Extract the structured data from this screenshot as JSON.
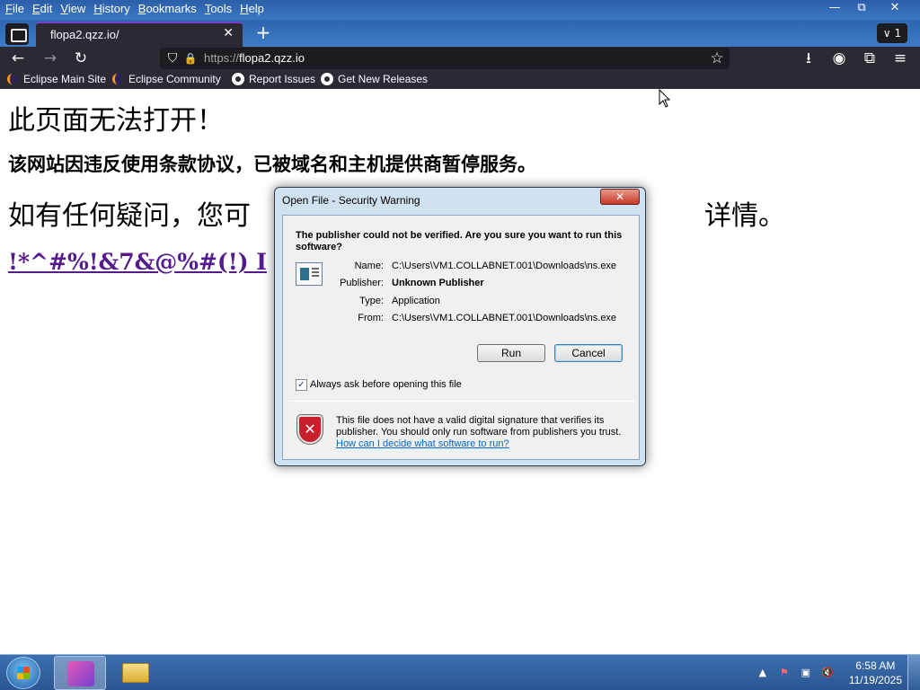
{
  "menu": [
    "File",
    "Edit",
    "View",
    "History",
    "Bookmarks",
    "Tools",
    "Help"
  ],
  "window_controls": {
    "minimize": "—",
    "restore": "⧉",
    "close": "✕"
  },
  "tab": {
    "title": "flopa2.qzz.io/",
    "close": "✕",
    "new_tab": "+",
    "count": "∨ 1"
  },
  "nav": {
    "back": "←",
    "forward": "→",
    "reload": "↻",
    "shield": "⛉",
    "lock": "🔒",
    "star": "☆",
    "download": "⭳",
    "account": "◉",
    "extensions": "⧉",
    "menu": "≡"
  },
  "url": {
    "scheme": "https://",
    "host": "flopa2.qzz.io"
  },
  "bookmarks": [
    "Eclipse Main Site",
    "Eclipse Community",
    "Report Issues",
    "Get New Releases"
  ],
  "page": {
    "heading1": "此页面无法打开！",
    "heading2": "该网站因违反使用条款协议，已被域名和主机提供商暂停服务。",
    "heading3_left": "如有任何疑问，您可",
    "heading3_right": "详情。",
    "link": "!*^#%!&7&@%#(!) I"
  },
  "dialog": {
    "title": "Open File - Security Warning",
    "close": "✕",
    "heading": "The publisher could not be verified.  Are you sure you want to run this software?",
    "fields": [
      {
        "label": "Name:",
        "value": "C:\\Users\\VM1.COLLABNET.001\\Downloads\\ns.exe",
        "bold": false
      },
      {
        "label": "Publisher:",
        "value": "Unknown Publisher",
        "bold": true
      },
      {
        "label": "Type:",
        "value": "Application",
        "bold": false
      },
      {
        "label": "From:",
        "value": "C:\\Users\\VM1.COLLABNET.001\\Downloads\\ns.exe",
        "bold": false
      }
    ],
    "run_label": "Run",
    "cancel_label": "Cancel",
    "checkbox_checked": true,
    "checkbox_mark": "✓",
    "checkbox_label": "Always ask before opening this file",
    "shield_mark": "✕",
    "warning_text": "This file does not have a valid digital signature that verifies its publisher.  You should only run software from publishers you trust.",
    "help_link": "How can I decide what software to run?"
  },
  "taskbar": {
    "tray_arrow": "▲",
    "tray_flag": "⚑",
    "tray_network": "▣",
    "tray_volume": "🔇",
    "time": "6:58 AM",
    "date": "11/19/2025"
  }
}
